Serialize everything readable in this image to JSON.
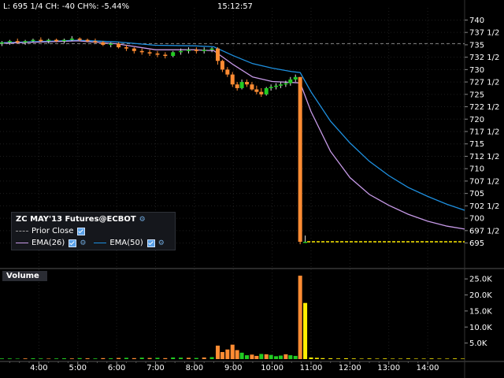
{
  "header": {
    "quote": "L: 695 1/4 CH: -40 CH%: -5.44%",
    "time": "15:12:57"
  },
  "legend": {
    "title": "ZC MAY'13 Futures@ECBOT",
    "prior_close": "Prior Close",
    "ema26": "EMA(26)",
    "ema50": "EMA(50)"
  },
  "volume_tab": "Volume",
  "colors": {
    "background": "#000000",
    "up_candle": "#22cc22",
    "down_candle": "#ff8c33",
    "ema26": "#c79ae8",
    "ema50": "#1e90e0",
    "last_price_line": "#ffee00",
    "prior_close_line": "#888888",
    "volume_up": "#22cc22",
    "volume_down": "#ff8c33",
    "volume_spike": "#ffee00"
  },
  "chart_data": {
    "type": "candlestick",
    "price_axis_labels": [
      "740",
      "737 1/2",
      "735",
      "732 1/2",
      "730",
      "727 1/2",
      "725",
      "722 1/2",
      "720",
      "717 1/2",
      "715",
      "712 1/2",
      "710",
      "707 1/2",
      "705",
      "702 1/2",
      "700",
      "697 1/2",
      "695"
    ],
    "ylim": [
      693.5,
      741.5
    ],
    "volume_axis_labels": [
      "25.0K",
      "20.0K",
      "15.0K",
      "10.0K",
      "5.0K"
    ],
    "volume_ylim": [
      0,
      27000
    ],
    "time_axis_labels": [
      "4:00",
      "5:00",
      "6:00",
      "7:00",
      "8:00",
      "9:00",
      "10:00",
      "11:00",
      "12:00",
      "13:00",
      "14:00"
    ],
    "hour_range": [
      3.0,
      14.95
    ],
    "prior_close": 735.25,
    "last_price": 695.25,
    "candles": [
      {
        "t": 3.05,
        "o": 735.25,
        "h": 735.75,
        "l": 734.75,
        "c": 735.5
      },
      {
        "t": 3.25,
        "o": 735.5,
        "h": 736.0,
        "l": 735.0,
        "c": 735.75
      },
      {
        "t": 3.45,
        "o": 735.75,
        "h": 736.25,
        "l": 735.25,
        "c": 735.5
      },
      {
        "t": 3.65,
        "o": 735.5,
        "h": 736.0,
        "l": 735.0,
        "c": 735.75
      },
      {
        "t": 3.85,
        "o": 735.75,
        "h": 736.25,
        "l": 735.5,
        "c": 736.0
      },
      {
        "t": 4.05,
        "o": 736.0,
        "h": 736.5,
        "l": 735.5,
        "c": 735.75
      },
      {
        "t": 4.25,
        "o": 735.75,
        "h": 736.25,
        "l": 735.25,
        "c": 736.0
      },
      {
        "t": 4.45,
        "o": 736.0,
        "h": 736.25,
        "l": 735.5,
        "c": 735.75
      },
      {
        "t": 4.65,
        "o": 735.75,
        "h": 736.25,
        "l": 735.25,
        "c": 736.0
      },
      {
        "t": 4.85,
        "o": 736.0,
        "h": 736.75,
        "l": 735.75,
        "c": 736.25
      },
      {
        "t": 5.05,
        "o": 736.25,
        "h": 736.5,
        "l": 735.75,
        "c": 736.0
      },
      {
        "t": 5.25,
        "o": 736.0,
        "h": 736.25,
        "l": 735.5,
        "c": 735.75
      },
      {
        "t": 5.45,
        "o": 735.75,
        "h": 736.25,
        "l": 735.25,
        "c": 735.5
      },
      {
        "t": 5.65,
        "o": 735.5,
        "h": 735.75,
        "l": 734.75,
        "c": 735.0
      },
      {
        "t": 5.85,
        "o": 735.0,
        "h": 735.5,
        "l": 734.5,
        "c": 735.25
      },
      {
        "t": 6.05,
        "o": 735.25,
        "h": 735.5,
        "l": 734.25,
        "c": 734.5
      },
      {
        "t": 6.25,
        "o": 734.5,
        "h": 735.0,
        "l": 733.75,
        "c": 734.25
      },
      {
        "t": 6.45,
        "o": 734.25,
        "h": 734.5,
        "l": 733.25,
        "c": 733.75
      },
      {
        "t": 6.65,
        "o": 733.75,
        "h": 734.25,
        "l": 733.0,
        "c": 733.5
      },
      {
        "t": 6.85,
        "o": 733.5,
        "h": 734.0,
        "l": 732.75,
        "c": 733.25
      },
      {
        "t": 7.05,
        "o": 733.25,
        "h": 733.75,
        "l": 732.5,
        "c": 733.0
      },
      {
        "t": 7.25,
        "o": 733.0,
        "h": 733.5,
        "l": 732.25,
        "c": 732.75
      },
      {
        "t": 7.45,
        "o": 732.75,
        "h": 733.75,
        "l": 732.5,
        "c": 733.5
      },
      {
        "t": 7.65,
        "o": 733.5,
        "h": 734.25,
        "l": 733.0,
        "c": 733.75
      },
      {
        "t": 7.85,
        "o": 733.75,
        "h": 734.5,
        "l": 733.25,
        "c": 734.0
      },
      {
        "t": 8.05,
        "o": 734.0,
        "h": 734.5,
        "l": 733.25,
        "c": 733.75
      },
      {
        "t": 8.25,
        "o": 733.75,
        "h": 734.5,
        "l": 733.25,
        "c": 734.0
      },
      {
        "t": 8.45,
        "o": 734.0,
        "h": 734.5,
        "l": 733.5,
        "c": 734.25
      },
      {
        "t": 8.6,
        "o": 734.25,
        "h": 734.5,
        "l": 731.0,
        "c": 731.75
      },
      {
        "t": 8.72,
        "o": 731.75,
        "h": 732.0,
        "l": 729.5,
        "c": 730.0
      },
      {
        "t": 8.85,
        "o": 730.0,
        "h": 730.5,
        "l": 728.5,
        "c": 729.0
      },
      {
        "t": 8.98,
        "o": 729.0,
        "h": 729.5,
        "l": 726.5,
        "c": 727.0
      },
      {
        "t": 9.1,
        "o": 727.0,
        "h": 727.5,
        "l": 725.75,
        "c": 726.25
      },
      {
        "t": 9.22,
        "o": 726.25,
        "h": 728.0,
        "l": 726.0,
        "c": 727.5
      },
      {
        "t": 9.35,
        "o": 727.5,
        "h": 728.0,
        "l": 726.5,
        "c": 727.0
      },
      {
        "t": 9.48,
        "o": 727.0,
        "h": 727.5,
        "l": 725.75,
        "c": 726.0
      },
      {
        "t": 9.6,
        "o": 726.0,
        "h": 726.75,
        "l": 725.0,
        "c": 725.5
      },
      {
        "t": 9.72,
        "o": 725.5,
        "h": 726.25,
        "l": 724.5,
        "c": 725.0
      },
      {
        "t": 9.85,
        "o": 725.0,
        "h": 726.5,
        "l": 724.75,
        "c": 726.25
      },
      {
        "t": 9.97,
        "o": 726.25,
        "h": 727.0,
        "l": 725.75,
        "c": 726.5
      },
      {
        "t": 10.1,
        "o": 726.5,
        "h": 727.25,
        "l": 726.0,
        "c": 726.75
      },
      {
        "t": 10.22,
        "o": 726.75,
        "h": 727.5,
        "l": 726.25,
        "c": 727.0
      },
      {
        "t": 10.35,
        "o": 727.0,
        "h": 727.75,
        "l": 726.5,
        "c": 727.25
      },
      {
        "t": 10.47,
        "o": 727.25,
        "h": 728.5,
        "l": 726.75,
        "c": 728.0
      },
      {
        "t": 10.6,
        "o": 728.0,
        "h": 729.0,
        "l": 727.5,
        "c": 728.5
      },
      {
        "t": 10.72,
        "o": 728.5,
        "h": 728.5,
        "l": 694.75,
        "c": 695.25
      },
      {
        "t": 10.85,
        "o": 695.25,
        "h": 696.5,
        "l": 695.0,
        "c": 695.25
      }
    ],
    "ema26": [
      [
        3.0,
        735.3
      ],
      [
        5.0,
        735.8
      ],
      [
        6.0,
        735.2
      ],
      [
        7.0,
        734.0
      ],
      [
        8.0,
        734.0
      ],
      [
        8.5,
        733.8
      ],
      [
        9.0,
        731.0
      ],
      [
        9.5,
        728.5
      ],
      [
        10.0,
        727.6
      ],
      [
        10.5,
        727.4
      ],
      [
        10.72,
        727.3
      ],
      [
        11.0,
        721.5
      ],
      [
        11.5,
        713.5
      ],
      [
        12.0,
        708.2
      ],
      [
        12.5,
        704.8
      ],
      [
        13.0,
        702.6
      ],
      [
        13.5,
        700.8
      ],
      [
        14.0,
        699.4
      ],
      [
        14.5,
        698.4
      ],
      [
        14.95,
        697.8
      ]
    ],
    "ema50": [
      [
        3.0,
        735.4
      ],
      [
        5.0,
        735.9
      ],
      [
        6.0,
        735.6
      ],
      [
        7.0,
        734.9
      ],
      [
        8.0,
        734.8
      ],
      [
        8.5,
        734.6
      ],
      [
        9.0,
        732.8
      ],
      [
        9.5,
        731.2
      ],
      [
        10.0,
        730.3
      ],
      [
        10.5,
        729.6
      ],
      [
        10.72,
        729.4
      ],
      [
        11.0,
        725.5
      ],
      [
        11.5,
        719.6
      ],
      [
        12.0,
        715.2
      ],
      [
        12.5,
        711.5
      ],
      [
        13.0,
        708.6
      ],
      [
        13.5,
        706.2
      ],
      [
        14.0,
        704.4
      ],
      [
        14.5,
        702.8
      ],
      [
        14.95,
        701.6
      ]
    ],
    "volume": [
      {
        "t": 3.05,
        "v": 200,
        "up": true
      },
      {
        "t": 3.25,
        "v": 200,
        "up": true
      },
      {
        "t": 3.45,
        "v": 150,
        "up": true
      },
      {
        "t": 3.65,
        "v": 200,
        "up": false
      },
      {
        "t": 3.85,
        "v": 250,
        "up": true
      },
      {
        "t": 4.05,
        "v": 200,
        "up": true
      },
      {
        "t": 4.25,
        "v": 150,
        "up": false
      },
      {
        "t": 4.45,
        "v": 200,
        "up": true
      },
      {
        "t": 4.65,
        "v": 250,
        "up": true
      },
      {
        "t": 4.85,
        "v": 200,
        "up": false
      },
      {
        "t": 5.05,
        "v": 300,
        "up": true
      },
      {
        "t": 5.25,
        "v": 250,
        "up": false
      },
      {
        "t": 5.45,
        "v": 200,
        "up": true
      },
      {
        "t": 5.65,
        "v": 300,
        "up": false
      },
      {
        "t": 5.85,
        "v": 250,
        "up": true
      },
      {
        "t": 6.05,
        "v": 350,
        "up": false
      },
      {
        "t": 6.25,
        "v": 400,
        "up": true
      },
      {
        "t": 6.45,
        "v": 300,
        "up": false
      },
      {
        "t": 6.65,
        "v": 450,
        "up": true
      },
      {
        "t": 6.85,
        "v": 350,
        "up": false
      },
      {
        "t": 7.05,
        "v": 400,
        "up": true
      },
      {
        "t": 7.25,
        "v": 300,
        "up": false
      },
      {
        "t": 7.45,
        "v": 500,
        "up": true
      },
      {
        "t": 7.65,
        "v": 450,
        "up": true
      },
      {
        "t": 7.85,
        "v": 400,
        "up": false
      },
      {
        "t": 8.05,
        "v": 350,
        "up": true
      },
      {
        "t": 8.25,
        "v": 500,
        "up": false
      },
      {
        "t": 8.45,
        "v": 600,
        "up": true
      },
      {
        "t": 8.6,
        "v": 4200,
        "up": false
      },
      {
        "t": 8.72,
        "v": 2200,
        "up": false
      },
      {
        "t": 8.85,
        "v": 3000,
        "up": false
      },
      {
        "t": 8.98,
        "v": 4500,
        "up": false
      },
      {
        "t": 9.1,
        "v": 2800,
        "up": false
      },
      {
        "t": 9.22,
        "v": 2000,
        "up": true
      },
      {
        "t": 9.35,
        "v": 1200,
        "up": true
      },
      {
        "t": 9.48,
        "v": 1400,
        "up": false
      },
      {
        "t": 9.6,
        "v": 1000,
        "up": false
      },
      {
        "t": 9.72,
        "v": 1600,
        "up": true
      },
      {
        "t": 9.85,
        "v": 1500,
        "up": false
      },
      {
        "t": 9.97,
        "v": 1300,
        "up": true
      },
      {
        "t": 10.1,
        "v": 900,
        "up": true
      },
      {
        "t": 10.22,
        "v": 1100,
        "up": true
      },
      {
        "t": 10.35,
        "v": 1500,
        "up": false
      },
      {
        "t": 10.47,
        "v": 1200,
        "up": true
      },
      {
        "t": 10.6,
        "v": 1000,
        "up": true
      },
      {
        "t": 10.72,
        "v": 26000,
        "up": false
      },
      {
        "t": 10.85,
        "v": 17500,
        "up": null
      },
      {
        "t": 11.0,
        "v": 500,
        "up": null
      },
      {
        "t": 11.15,
        "v": 400,
        "up": null
      },
      {
        "t": 11.3,
        "v": 300,
        "up": null
      },
      {
        "t": 11.5,
        "v": 250,
        "up": null
      },
      {
        "t": 11.7,
        "v": 200,
        "up": null
      },
      {
        "t": 11.9,
        "v": 250,
        "up": null
      },
      {
        "t": 12.1,
        "v": 200,
        "up": null
      },
      {
        "t": 12.3,
        "v": 150,
        "up": null
      },
      {
        "t": 12.5,
        "v": 200,
        "up": null
      },
      {
        "t": 12.7,
        "v": 150,
        "up": null
      },
      {
        "t": 12.9,
        "v": 200,
        "up": null
      },
      {
        "t": 13.1,
        "v": 150,
        "up": null
      },
      {
        "t": 13.3,
        "v": 150,
        "up": null
      },
      {
        "t": 13.5,
        "v": 200,
        "up": null
      },
      {
        "t": 13.7,
        "v": 150,
        "up": null
      },
      {
        "t": 13.9,
        "v": 150,
        "up": null
      },
      {
        "t": 14.1,
        "v": 200,
        "up": null
      },
      {
        "t": 14.3,
        "v": 150,
        "up": null
      },
      {
        "t": 14.5,
        "v": 150,
        "up": null
      },
      {
        "t": 14.7,
        "v": 200,
        "up": null
      },
      {
        "t": 14.9,
        "v": 150,
        "up": null
      }
    ]
  }
}
